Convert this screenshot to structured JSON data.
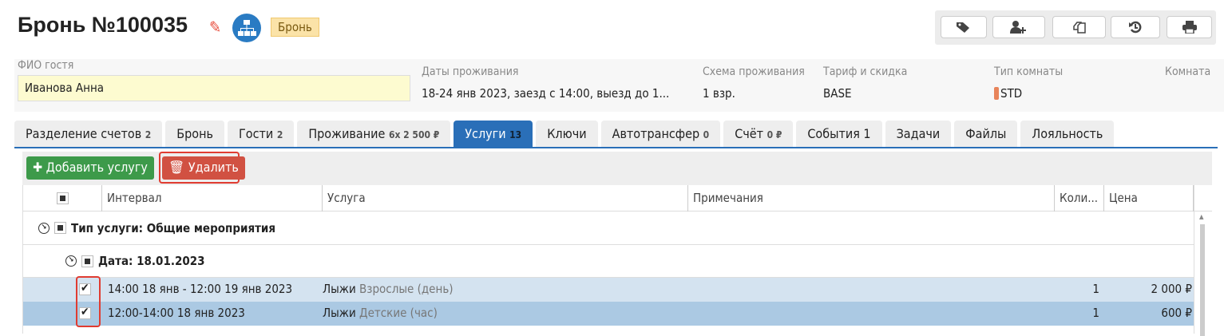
{
  "header": {
    "title": "Бронь №100035",
    "badge": "Бронь"
  },
  "toolbar_icons": [
    "tags-icon",
    "add-user-icon",
    "copy-icon",
    "history-icon",
    "print-icon"
  ],
  "info": {
    "guest_label": "ФИО гостя",
    "guest_value": "Иванова Анна",
    "dates_label": "Даты проживания",
    "dates_value": "18-24 янв 2023, заезд с 14:00, выезд до 1...",
    "scheme_label": "Схема проживания",
    "scheme_value": "1 взр.",
    "tariff_label": "Тариф и скидка",
    "tariff_value": "BASE",
    "roomtype_label": "Тип комнаты",
    "roomtype_value": "STD",
    "room_label": "Комната"
  },
  "tabs": [
    {
      "label": "Разделение счетов",
      "count": "2"
    },
    {
      "label": "Бронь",
      "count": ""
    },
    {
      "label": "Гости",
      "count": "2"
    },
    {
      "label": "Проживание",
      "count": "6x 2 500 ₽"
    },
    {
      "label": "Услуги",
      "count": "13"
    },
    {
      "label": "Ключи",
      "count": ""
    },
    {
      "label": "Автотрансфер",
      "count": "0"
    },
    {
      "label": "Счёт",
      "count": "0 ₽"
    },
    {
      "label": "События 1",
      "count": ""
    },
    {
      "label": "Задачи",
      "count": ""
    },
    {
      "label": "Файлы",
      "count": ""
    },
    {
      "label": "Лояльность",
      "count": ""
    }
  ],
  "actions": {
    "add": "Добавить услугу",
    "delete": "Удалить"
  },
  "columns": [
    "Интервал",
    "Услуга",
    "Примечания",
    "Коли...",
    "Цена"
  ],
  "group": "Тип услуги: Общие мероприятия",
  "subgroup": "Дата: 18.01.2023",
  "rows": [
    {
      "interval": "14:00 18 янв - 12:00 19 янв 2023",
      "service": "Лыжи",
      "variant": "Взрослые (день)",
      "qty": "1",
      "price": "2 000 ₽"
    },
    {
      "interval": "12:00-14:00 18 янв 2023",
      "service": "Лыжи",
      "variant": "Детские (час)",
      "qty": "1",
      "price": "600 ₽"
    }
  ],
  "colors": {
    "accent": "#2a6fb8",
    "add": "#3d9a4a",
    "delete": "#d15142",
    "highlight": "#e03c31"
  }
}
